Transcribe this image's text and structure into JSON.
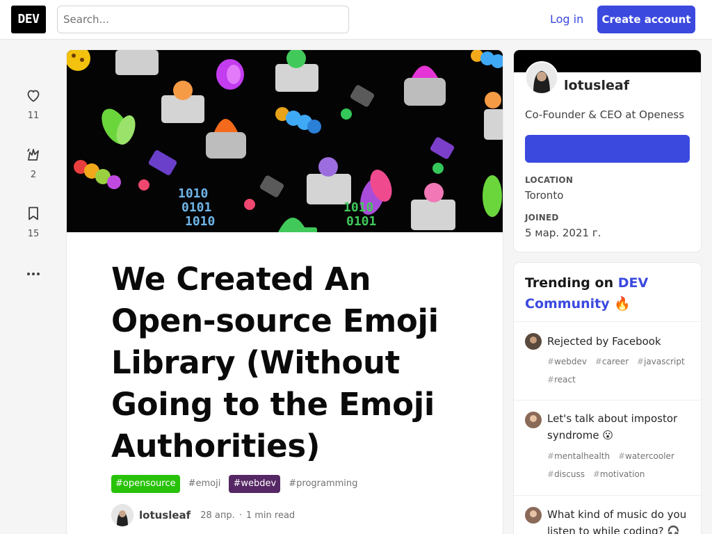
{
  "header": {
    "logo_text": "DEV",
    "search_placeholder": "Search...",
    "login_label": "Log in",
    "create_account_label": "Create account"
  },
  "reactions": {
    "likes": "11",
    "unicorns": "2",
    "bookmarks": "15"
  },
  "article": {
    "title": "We Created An Open-source Emoji Library (Without Going to the Emoji Authorities)",
    "tags": [
      {
        "label": "#opensource",
        "style": "green"
      },
      {
        "label": "#emoji",
        "style": "plain"
      },
      {
        "label": "#webdev",
        "style": "purple"
      },
      {
        "label": "#programming",
        "style": "plain"
      }
    ],
    "author": "lotusleaf",
    "date": "28 апр.",
    "read_time": "1 min read"
  },
  "profile": {
    "name": "lotusleaf",
    "bio": "Co-Founder & CEO at Openess",
    "location_label": "LOCATION",
    "location": "Toronto",
    "joined_label": "JOINED",
    "joined": "5 мар. 2021 г."
  },
  "trending": {
    "heading_prefix": "Trending on ",
    "heading_accent": "DEV Community",
    "heading_emoji": "🔥",
    "items": [
      {
        "title": "Rejected by Facebook",
        "tags": [
          "webdev",
          "career",
          "javascript",
          "react"
        ]
      },
      {
        "title": "Let's talk about impostor syndrome 😮",
        "tags": [
          "mentalhealth",
          "watercooler",
          "discuss",
          "motivation"
        ]
      },
      {
        "title": "What kind of music do you listen to while coding? 🎧",
        "tags": []
      }
    ]
  },
  "colors": {
    "brand": "#3b49df",
    "opensource_tag": "#28c20a",
    "webdev_tag": "#562765"
  }
}
